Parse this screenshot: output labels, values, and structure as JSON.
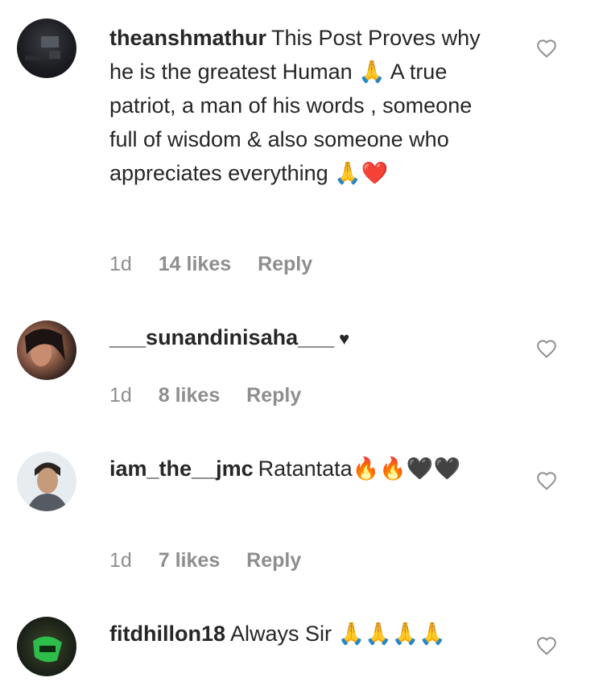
{
  "comments": [
    {
      "username": "theanshmathur",
      "text": "This Post Proves why he is the greatest Human 🙏 A true patriot, a man of his words , someone full of wisdom & also someone who appreciates everything 🙏❤️",
      "time": "1d",
      "likes": "14 likes",
      "reply": "Reply"
    },
    {
      "username": "___sunandinisaha___",
      "text": "♥",
      "time": "1d",
      "likes": "8 likes",
      "reply": "Reply"
    },
    {
      "username": "iam_the__jmc",
      "text": "Ratantata🔥🔥🖤🖤",
      "time": "1d",
      "likes": "7 likes",
      "reply": "Reply"
    },
    {
      "username": "fitdhillon18",
      "text": "Always Sir 🙏🙏🙏🙏",
      "time": "",
      "likes": "",
      "reply": ""
    }
  ],
  "colors": {
    "text": "#262626",
    "meta": "#8e8e8e",
    "heart_outline": "#8e8e8e"
  },
  "icons": [
    "like-heart-icon"
  ]
}
